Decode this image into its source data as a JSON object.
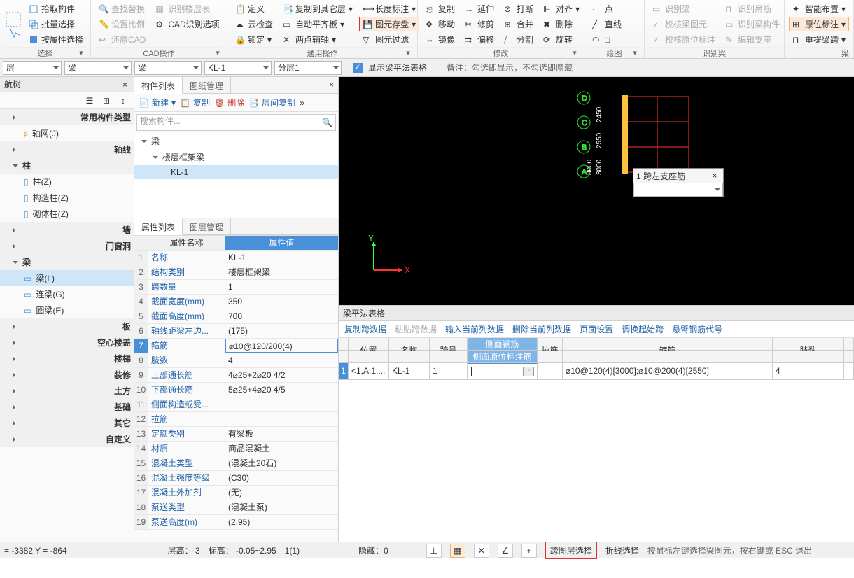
{
  "ribbon": {
    "select": {
      "pick": "拾取构件",
      "batch": "批量选择",
      "attr": "按属性选择",
      "label": "选择"
    },
    "cad": {
      "find": "查找替换",
      "scale": "设置比例",
      "restore": "还原CAD",
      "floor": "识别楼层表",
      "option": "CAD识别选项",
      "label": "CAD操作"
    },
    "common": {
      "def": "定义",
      "cloud": "云检查",
      "lock": "锁定",
      "copy": "复制到其它层",
      "flat": "自动平齐板",
      "axis": "两点辅轴",
      "length": "长度标注",
      "save": "图元存盘",
      "filter": "图元过滤",
      "label": "通用操作"
    },
    "modify": {
      "copy": "复制",
      "move": "移动",
      "mirror": "镜像",
      "extend": "延伸",
      "trim": "修剪",
      "offset": "偏移",
      "break": "打断",
      "merge": "合并",
      "split": "分割",
      "align": "对齐",
      "delete": "删除",
      "rotate": "旋转",
      "label": "修改"
    },
    "draw": {
      "point": "点",
      "line": "直线",
      "arc": "□",
      "label": "绘图"
    },
    "ident": {
      "beam": "识别梁",
      "check_beam": "校核梁图元",
      "check_orig": "校核原位标注",
      "hoist": "识别吊筋",
      "comp": "识别梁构件",
      "edit": "编辑支座",
      "label": "识别梁"
    },
    "right": {
      "smart": "智能布置",
      "orig": "原位标注",
      "re": "重提梁跨"
    }
  },
  "bar2": {
    "cb1": "层",
    "cb2": "梁",
    "cb3": "梁",
    "cb4": "KL-1",
    "cb5": "分层1",
    "chk": "显示梁平法表格",
    "note": "备注：勾选即显示，不勾选即隐藏"
  },
  "nav": {
    "title": "航树",
    "common": "常用构件类型",
    "grid": "轴网(J)",
    "axis": "轴线",
    "col": "柱",
    "col_z": "柱(Z)",
    "col_gz": "构造柱(Z)",
    "col_qz": "砌体柱(Z)",
    "wall": "墙",
    "open": "门窗洞",
    "beam": "梁",
    "beam_l": "梁(L)",
    "beam_lg": "连梁(G)",
    "beam_qe": "圈梁(E)",
    "slab": "板",
    "hollow": "空心楼盖",
    "stair": "楼梯",
    "decor": "装修",
    "earth": "土方",
    "found": "基础",
    "other": "其它",
    "custom": "自定义"
  },
  "comp": {
    "tab1": "构件列表",
    "tab2": "图纸管理",
    "new": "新建",
    "copy": "复制",
    "del": "删除",
    "floor_copy": "层间复制",
    "search": "搜索构件...",
    "root": "梁",
    "type": "楼层框架梁",
    "item": "KL-1"
  },
  "prop": {
    "tab1": "属性列表",
    "tab2": "图层管理",
    "hname": "属性名称",
    "hval": "属性值",
    "rows": [
      {
        "n": "1",
        "k": "名称",
        "v": "KL-1"
      },
      {
        "n": "2",
        "k": "结构类别",
        "v": "楼层框架梁"
      },
      {
        "n": "3",
        "k": "跨数量",
        "v": "1"
      },
      {
        "n": "4",
        "k": "截面宽度(mm)",
        "v": "350"
      },
      {
        "n": "5",
        "k": "截面高度(mm)",
        "v": "700"
      },
      {
        "n": "6",
        "k": "轴线距梁左边...",
        "v": "(175)"
      },
      {
        "n": "7",
        "k": "箍筋",
        "v": "⌀10@120/200(4)"
      },
      {
        "n": "8",
        "k": "肢数",
        "v": "4"
      },
      {
        "n": "9",
        "k": "上部通长筋",
        "v": "4⌀25+2⌀20 4/2"
      },
      {
        "n": "10",
        "k": "下部通长筋",
        "v": "5⌀25+4⌀20 4/5"
      },
      {
        "n": "11",
        "k": "侧面构造或受...",
        "v": ""
      },
      {
        "n": "12",
        "k": "拉筋",
        "v": ""
      },
      {
        "n": "13",
        "k": "定额类别",
        "v": "有梁板"
      },
      {
        "n": "14",
        "k": "材质",
        "v": "商品混凝土"
      },
      {
        "n": "15",
        "k": "混凝土类型",
        "v": "(混凝土20石)"
      },
      {
        "n": "16",
        "k": "混凝土强度等级",
        "v": "(C30)"
      },
      {
        "n": "17",
        "k": "混凝土外加剂",
        "v": "(无)"
      },
      {
        "n": "18",
        "k": "泵送类型",
        "v": "(混凝土泵)"
      },
      {
        "n": "19",
        "k": "泵送高度(m)",
        "v": "(2.95)"
      }
    ]
  },
  "viewport": {
    "labels": {
      "a": "A",
      "b": "B",
      "c": "C",
      "d": "D"
    },
    "dims": {
      "d1": "3000",
      "d2": "2550",
      "d3": "2450",
      "t": "8000"
    },
    "popup": {
      "title": "1 跨左支座筋"
    }
  },
  "btable": {
    "title": "梁平法表格",
    "tb": {
      "copy": "复制跨数据",
      "paste": "粘贴跨数据",
      "input": "输入当前列数据",
      "del": "删除当前列数据",
      "page": "页面设置",
      "adj": "调换起始跨",
      "code": "悬臂钢筋代号"
    },
    "hd": {
      "pos": "位置",
      "name": "名称",
      "span": "跨号",
      "side1": "侧面钢筋",
      "side2": "侧面原位标注筋",
      "pull": "拉筋",
      "hoop": "箍筋",
      "limb": "肢数"
    },
    "row": {
      "n": "1",
      "pos": "<1,A;1,...",
      "name": "KL-1",
      "span": "1",
      "hoop": "⌀10@120(4)[3000];⌀10@200(4)[2550]",
      "limb": "4"
    }
  },
  "status": {
    "coord": "= -3382 Y = -864",
    "floor": "层高：  3",
    "elev": "标高：  -0.05~2.95",
    "cnt": "1(1)",
    "hide": "隐藏：0",
    "layer": "跨图层选择",
    "line": "折线选择",
    "tip": "按鼠标左键选择梁图元，按右键或 ESC 退出"
  }
}
